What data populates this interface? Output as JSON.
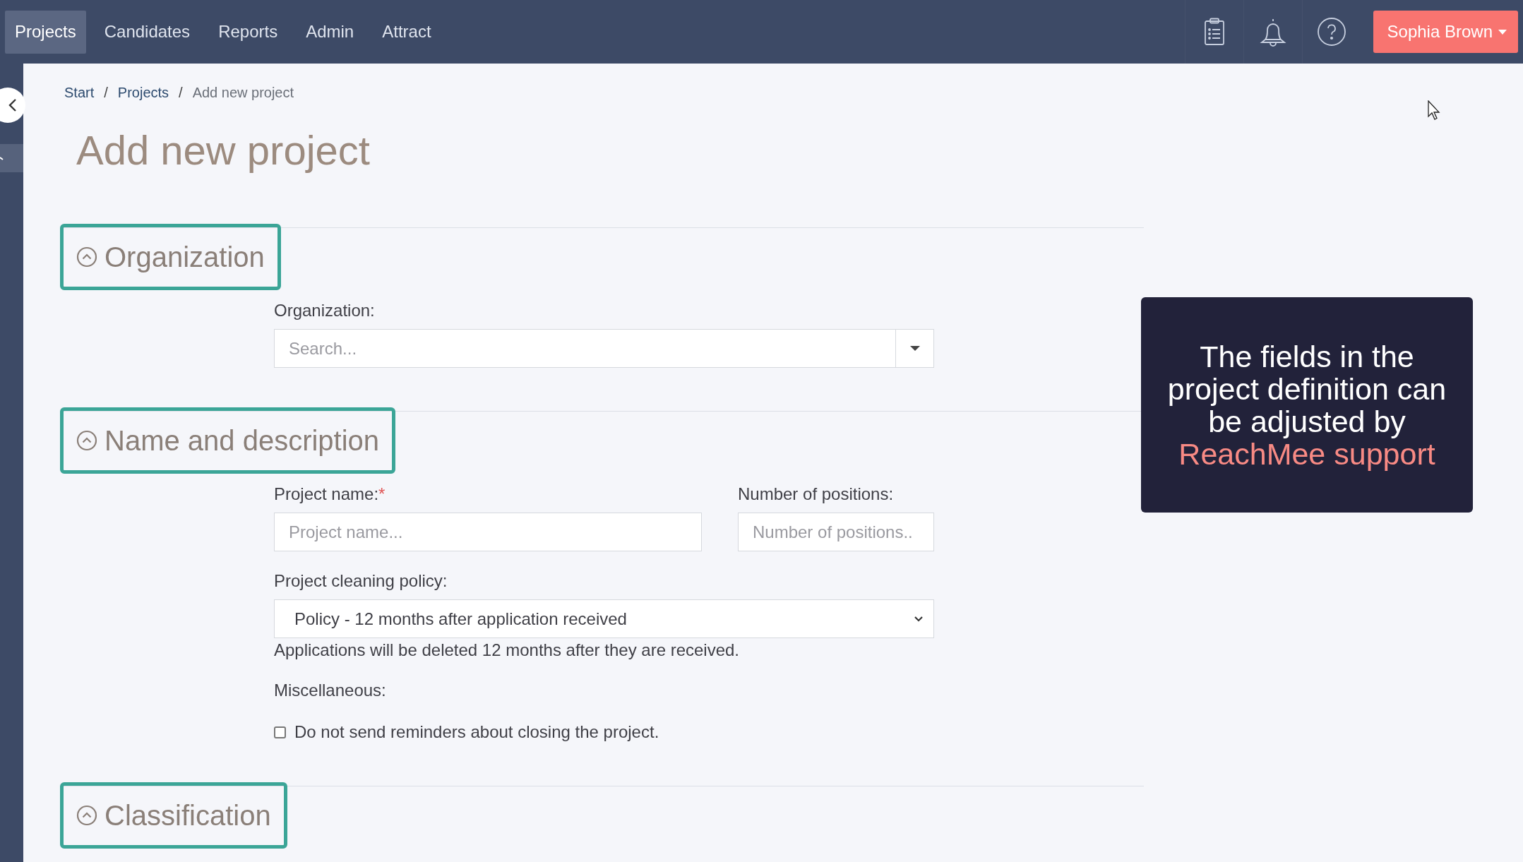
{
  "nav": {
    "tabs": [
      {
        "label": "Projects",
        "selected": true
      },
      {
        "label": "Candidates",
        "selected": false
      },
      {
        "label": "Reports",
        "selected": false
      },
      {
        "label": "Admin",
        "selected": false
      },
      {
        "label": "Attract",
        "selected": false
      }
    ],
    "user_menu": {
      "label": "Sophia Brown"
    }
  },
  "breadcrumb": [
    {
      "label": "Start",
      "kind": "link"
    },
    {
      "label": "/",
      "kind": "separator"
    },
    {
      "label": "Projects",
      "kind": "link"
    },
    {
      "label": "/",
      "kind": "separator"
    },
    {
      "label": "Add new project",
      "kind": "current"
    }
  ],
  "page_title": "Add new project",
  "sections": [
    {
      "title": "Organization",
      "expanded": true,
      "items": [
        {
          "kind": "combobox",
          "label": "Organization:",
          "placeholder": "Search..."
        }
      ]
    },
    {
      "title": "Name and description",
      "expanded": true,
      "items": [
        {
          "kind": "pair",
          "fields": [
            {
              "label": "Project name:",
              "required_mark": "*",
              "placeholder": "Project name..."
            },
            {
              "label": "Number of positions:",
              "placeholder": "Number of positions.."
            }
          ]
        },
        {
          "kind": "select",
          "label": "Project cleaning policy:",
          "value": "Policy - 12 months after application received",
          "help": "Applications will be deleted 12 months after they are received."
        },
        {
          "kind": "heading",
          "label": "Miscellaneous:"
        },
        {
          "kind": "checkbox",
          "label": "Do not send reminders about closing the project.",
          "checked": false
        }
      ]
    },
    {
      "title": "Classification",
      "expanded": true
    }
  ],
  "overlay": {
    "text": "The fields in the project definition can be adjusted by",
    "highlight": "ReachMee support"
  }
}
